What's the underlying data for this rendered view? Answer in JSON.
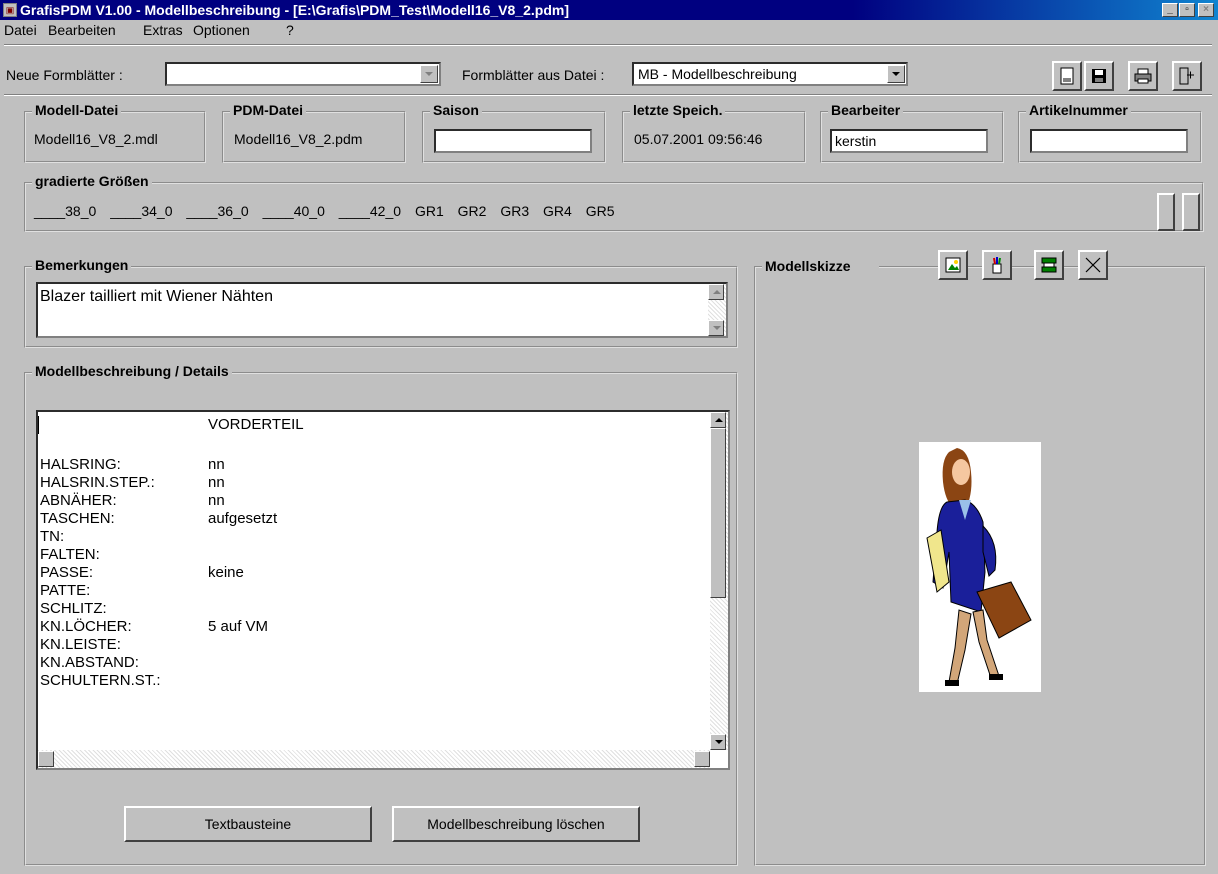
{
  "window": {
    "title": "GrafisPDM V1.00  -  Modellbeschreibung - [E:\\Grafis\\PDM_Test\\Modell16_V8_2.pdm]"
  },
  "menu": [
    "Datei",
    "Bearbeiten",
    "Extras",
    "Optionen",
    "?"
  ],
  "toolbar": {
    "neue_formblaetter_label": "Neue Formblätter :",
    "neue_formblaetter_value": "",
    "aus_datei_label": "Formblätter aus Datei :",
    "aus_datei_value": "MB - Modellbeschreibung",
    "buttons": [
      "new-sheet-icon",
      "save-icon",
      "print-icon",
      "exit-icon"
    ]
  },
  "header_fields": {
    "modell_datei": {
      "label": "Modell-Datei",
      "value": "Modell16_V8_2.mdl"
    },
    "pdm_datei": {
      "label": "PDM-Datei",
      "value": "Modell16_V8_2.pdm"
    },
    "saison": {
      "label": "Saison",
      "value": ""
    },
    "letzte_speich": {
      "label": "letzte Speich.",
      "value": "05.07.2001  09:56:46"
    },
    "bearbeiter": {
      "label": "Bearbeiter",
      "value": "kerstin"
    },
    "artikelnummer": {
      "label": "Artikelnummer",
      "value": ""
    }
  },
  "sizes": {
    "label": "gradierte Größen",
    "items": [
      "____38_0",
      "____34_0",
      "____36_0",
      "____40_0",
      "____42_0",
      "GR1",
      "GR2",
      "GR3",
      "GR4",
      "GR5"
    ]
  },
  "bemerkungen": {
    "label": "Bemerkungen",
    "value": "Blazer tailliert mit Wiener Nähten"
  },
  "details": {
    "label": "Modellbeschreibung / Details",
    "heading": "VORDERTEIL",
    "rows": [
      {
        "key": "HALSRING:",
        "value": "nn"
      },
      {
        "key": "HALSRIN.STEP.:",
        "value": "nn"
      },
      {
        "key": "ABNÄHER:",
        "value": "nn"
      },
      {
        "key": "TASCHEN:",
        "value": "aufgesetzt"
      },
      {
        "key": "TN:",
        "value": ""
      },
      {
        "key": "FALTEN:",
        "value": ""
      },
      {
        "key": "PASSE:",
        "value": "keine"
      },
      {
        "key": "PATTE:",
        "value": ""
      },
      {
        "key": "SCHLITZ:",
        "value": ""
      },
      {
        "key": "KN.LÖCHER:",
        "value": "5 auf VM"
      },
      {
        "key": "KN.LEISTE:",
        "value": ""
      },
      {
        "key": "KN.ABSTAND:",
        "value": ""
      },
      {
        "key": "SCHULTERN.ST.:",
        "value": ""
      }
    ]
  },
  "buttons": {
    "textbausteine": "Textbausteine",
    "loeschen": "Modellbeschreibung löschen"
  },
  "modellskizze": {
    "label": "Modellskizze",
    "tools": [
      "image-icon",
      "paint-icon",
      "scanner-icon",
      "delete-icon"
    ]
  }
}
